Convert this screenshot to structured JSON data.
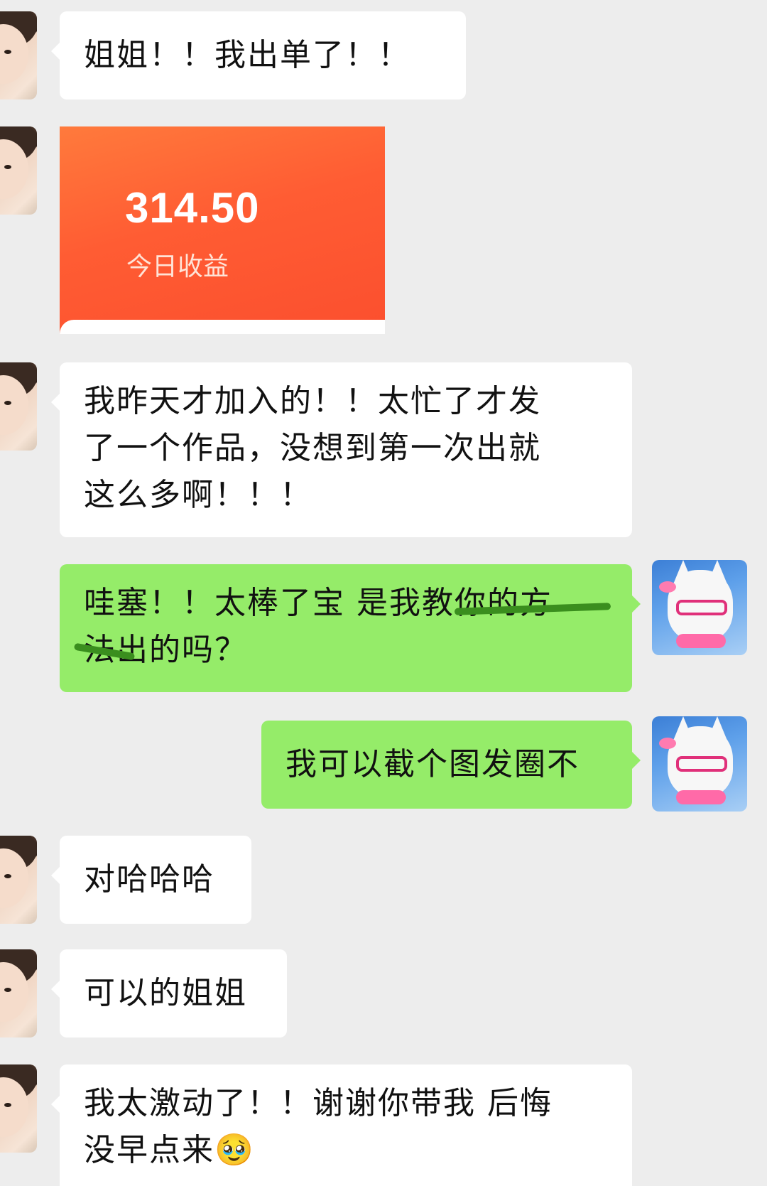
{
  "messages": [
    {
      "side": "left",
      "type": "text",
      "text": "姐姐！！我出单了！！"
    },
    {
      "side": "left",
      "type": "image",
      "amount": "314.50",
      "caption": "今日收益"
    },
    {
      "side": "left",
      "type": "text",
      "text": "我昨天才加入的！！太忙了才发\n了一个作品，没想到第一次出就\n这么多啊！！！"
    },
    {
      "side": "right",
      "type": "text",
      "text": "哇塞！！太棒了宝 是我教你的方\n法出的吗？"
    },
    {
      "side": "right",
      "type": "text",
      "text": "我可以截个图发圈不"
    },
    {
      "side": "left",
      "type": "text",
      "text": "对哈哈哈"
    },
    {
      "side": "left",
      "type": "text",
      "text": "可以的姐姐"
    },
    {
      "side": "left",
      "type": "text",
      "text": "我太激动了！！谢谢你带我 后悔\n没早点来🥹"
    }
  ],
  "colors": {
    "background": "#ededed",
    "incoming_bubble": "#ffffff",
    "outgoing_bubble": "#95ec69",
    "image_accent": "#fb4f2e"
  },
  "icons": {
    "left_avatar": "girl-avatar-icon",
    "right_avatar": "cat-avatar-icon"
  }
}
